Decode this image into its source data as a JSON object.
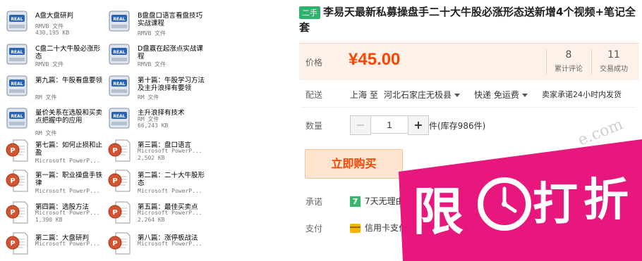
{
  "files": [
    {
      "name": "A盘大盘研判",
      "type": "RMVB 文件",
      "size": "430,195 KB",
      "icon": "real-media-icon"
    },
    {
      "name": "B盘盘口语言看盘技巧实战课程",
      "type": "RMVB 文件",
      "size": "",
      "icon": "real-media-icon"
    },
    {
      "name": "C盘二十大牛股必涨形态",
      "type": "RMVB 文件",
      "size": "",
      "icon": "real-media-icon"
    },
    {
      "name": "D盘赢在起涨点实战课程",
      "type": "RMVB 文件",
      "size": "",
      "icon": "real-media-icon"
    },
    {
      "name": "第九篇：牛股看盘要领",
      "type": "RM 文件",
      "size": "",
      "icon": "real-media-icon"
    },
    {
      "name": "第十篇：牛股学习方法及主升浪择有要领",
      "type": "RM 文件",
      "size": "",
      "icon": "real-media-icon"
    },
    {
      "name": "量价关系在选股和买卖点把握中的应用",
      "type": "RM 文件",
      "size": "",
      "icon": "real-media-icon"
    },
    {
      "name": "主升浪择有技术",
      "type": "RM 文件",
      "size": "66,243 KB",
      "icon": "real-media-icon"
    },
    {
      "name": "第七篇：如何止损和止盈",
      "type": "Microsoft PowerP...",
      "size": "",
      "icon": "powerpoint-icon"
    },
    {
      "name": "第三篇：盘口语言",
      "type": "Microsoft PowerP...",
      "size": "2,502 KB",
      "icon": "powerpoint-icon"
    },
    {
      "name": "第一篇：职业操盘手铁律",
      "type": "Microsoft PowerP...",
      "size": "",
      "icon": "powerpoint-icon"
    },
    {
      "name": "第二篇：二十大牛股形态",
      "type": "Microsoft PowerP...",
      "size": "",
      "icon": "powerpoint-icon"
    },
    {
      "name": "第四篇：选股方法",
      "type": "Microsoft PowerP...",
      "size": "1,390 KB",
      "icon": "powerpoint-icon"
    },
    {
      "name": "第五篇：最佳买卖点",
      "type": "Microsoft PowerP...",
      "size": "2,264 KB",
      "icon": "powerpoint-icon"
    },
    {
      "name": "第二篇：大盘研判",
      "type": "Microsoft PowerP...",
      "size": "",
      "icon": "powerpoint-icon"
    },
    {
      "name": "第八篇：涨停板战法",
      "type": "Microsoft PowerP...",
      "size": "",
      "icon": "powerpoint-icon"
    }
  ],
  "product": {
    "badge": "二手",
    "title": "李易天最新私募操盘手二十大牛股必涨形态送新增4个视频+笔记全套",
    "price_label": "价格",
    "price": "¥45.00",
    "reviews_count": "8",
    "reviews_label": "累计评论",
    "sales_count": "11",
    "sales_label": "交易成功",
    "shipping_label": "配送",
    "ship_from": "上海 至",
    "ship_to": "河北石家庄无极县",
    "ship_method": "快递 免运费",
    "ship_promise": "卖家承诺24小时内发货",
    "qty_label": "数量",
    "qty_value": "1",
    "qty_minus": "−",
    "qty_plus": "+",
    "stock": "件(库存986件)",
    "buy_label": "立即购买",
    "promise_label": "承诺",
    "promise_text": "7天无理由",
    "pay_label": "支付",
    "pay_text": "信用卡支付"
  },
  "stamp": {
    "chars": [
      "限",
      "打",
      "折"
    ],
    "color": "#e8177d"
  },
  "watermark": "e.com",
  "colors": {
    "accent": "#ff4400",
    "badge": "#2db36b",
    "stamp": "#e8177d"
  }
}
